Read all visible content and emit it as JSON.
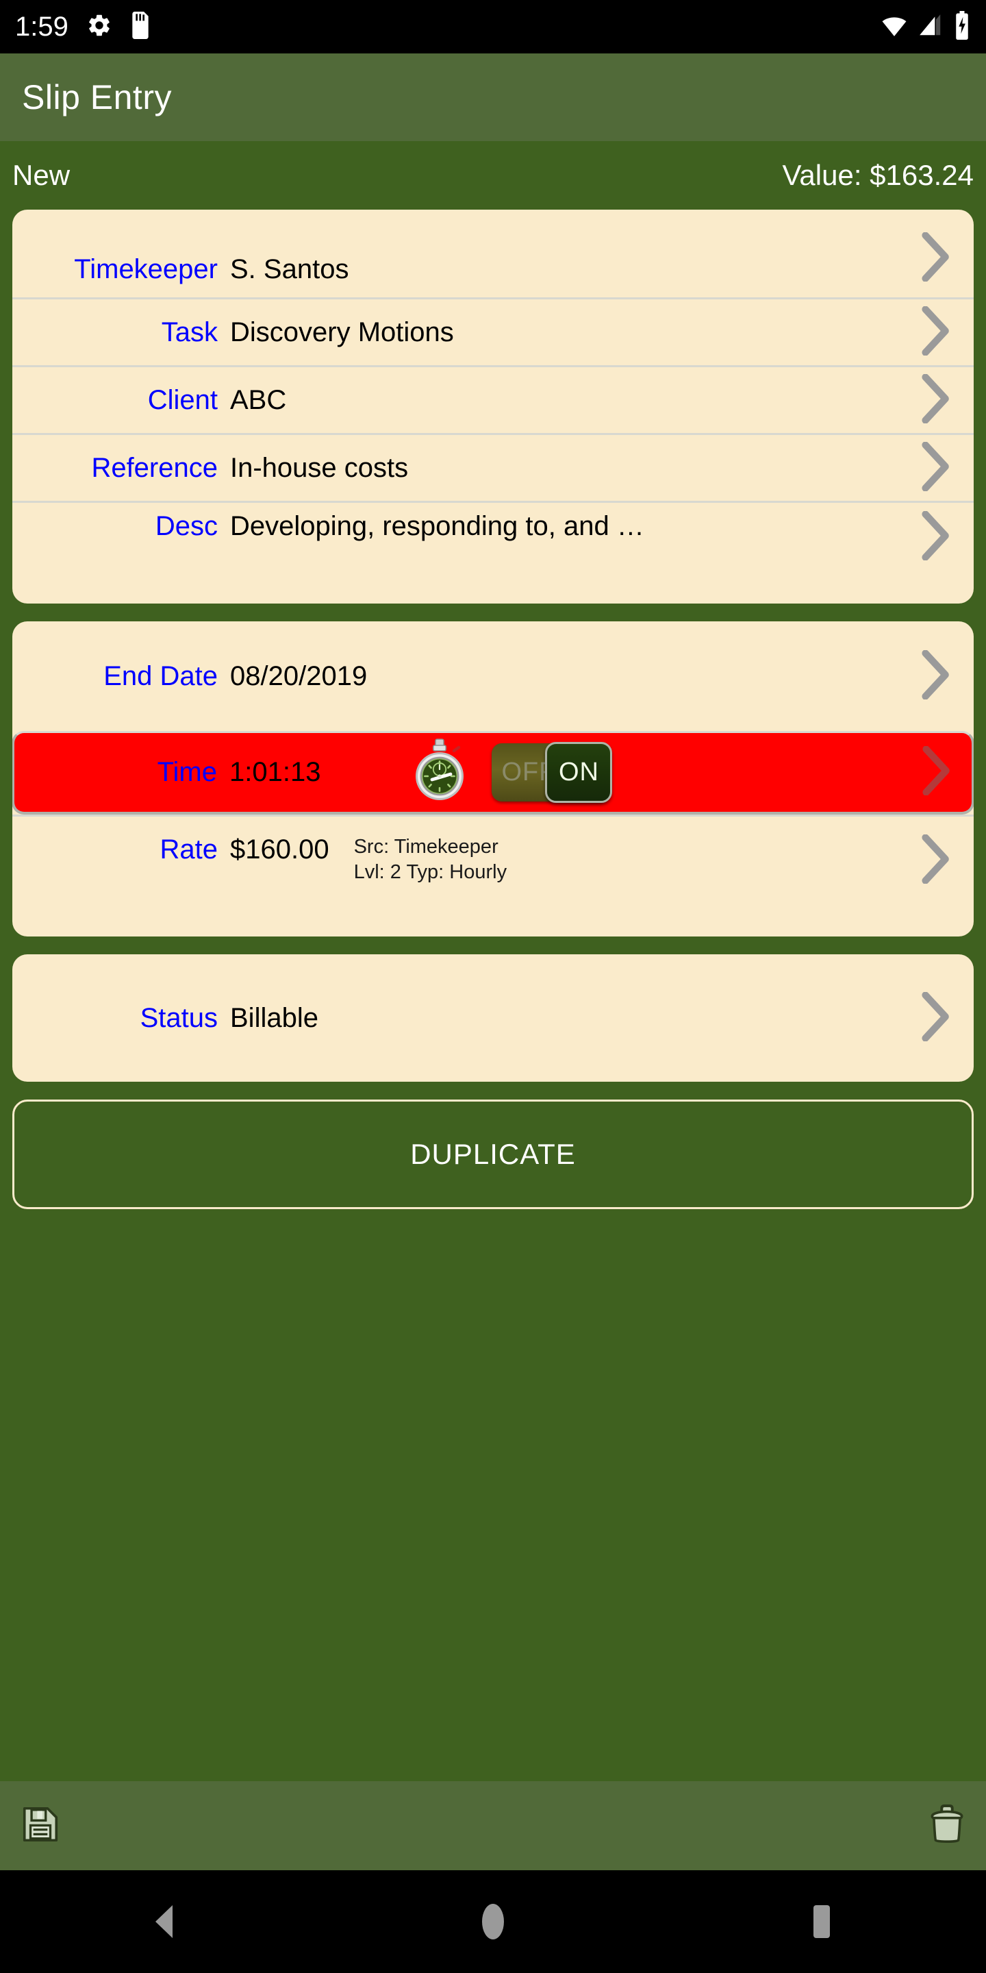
{
  "status_bar": {
    "time": "1:59",
    "left_icons": [
      "gear-icon",
      "sd-card-icon"
    ],
    "right_icons": [
      "wifi-icon",
      "cellular-signal-icon",
      "battery-charging-icon"
    ]
  },
  "app_bar": {
    "title": "Slip Entry",
    "background_color": "#516A39"
  },
  "sub_header": {
    "left": "New",
    "right": "Value: $163.24"
  },
  "colors": {
    "page_background": "#3F611F",
    "card_background": "#FAEBCB",
    "label": "#0000FF",
    "value": "#000000",
    "active_timer_row": "#FF0000",
    "toolbar_icon": "#C6D2B9"
  },
  "details_card": {
    "rows": [
      {
        "label": "Timekeeper",
        "value": "S. Santos"
      },
      {
        "label": "Task",
        "value": "Discovery Motions"
      },
      {
        "label": "Client",
        "value": "ABC"
      },
      {
        "label": "Reference",
        "value": "In-house costs"
      },
      {
        "label": "Desc",
        "value": "Developing, responding to, and …"
      }
    ]
  },
  "time_card": {
    "end_date": {
      "label": "End Date",
      "value": "08/20/2019"
    },
    "time": {
      "label": "Time",
      "value": "1:01:13",
      "timer_icon": "stopwatch-icon",
      "toggle": {
        "off_label": "OFF",
        "on_label": "ON",
        "state": "ON"
      }
    },
    "rate": {
      "label": "Rate",
      "value": "$160.00",
      "source_line": "Src: Timekeeper",
      "detail_line": "Lvl: 2   Typ: Hourly"
    }
  },
  "status_card": {
    "row": {
      "label": "Status",
      "value": "Billable"
    }
  },
  "duplicate_button": {
    "label": "DUPLICATE"
  },
  "toolbar": {
    "save_label": "save-icon",
    "delete_label": "delete-icon"
  },
  "nav_bar": {
    "back": "back-icon",
    "home": "home-icon",
    "recents": "recents-icon"
  }
}
